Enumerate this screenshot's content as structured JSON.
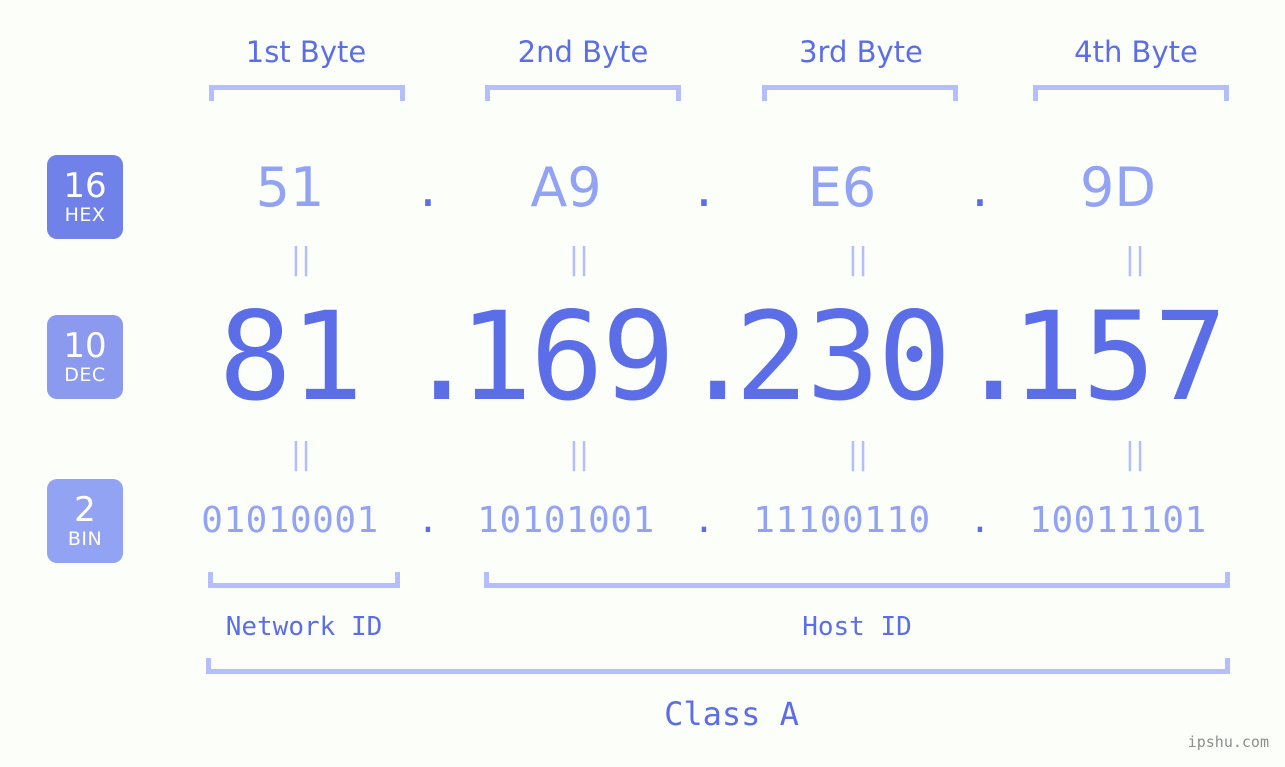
{
  "watermark": "ipshu.com",
  "byte_headers": [
    {
      "label": "1st Byte"
    },
    {
      "label": "2nd Byte"
    },
    {
      "label": "3rd Byte"
    },
    {
      "label": "4th Byte"
    }
  ],
  "radix_badges": [
    {
      "number": "16",
      "name": "HEX",
      "color": "#7081ea"
    },
    {
      "number": "10",
      "name": "DEC",
      "color": "#8b99ef"
    },
    {
      "number": "2",
      "name": "BIN",
      "color": "#93a3f4"
    }
  ],
  "separator": ".",
  "equals_mark": "||",
  "rows": {
    "hex": {
      "octets": [
        "51",
        "A9",
        "E6",
        "9D"
      ]
    },
    "dec": {
      "octets": [
        "81",
        "169",
        "230",
        "157"
      ]
    },
    "bin": {
      "octets": [
        "01010001",
        "10101001",
        "11100110",
        "10011101"
      ]
    }
  },
  "id_labels": {
    "network": "Network ID",
    "host": "Host ID"
  },
  "class_label": "Class A",
  "colors": {
    "background": "#fcfefa",
    "accent_strong": "#5b6ee8",
    "accent_light": "#93a3f4",
    "bracket": "#b4befa",
    "watermark": "#8e8e8e"
  }
}
